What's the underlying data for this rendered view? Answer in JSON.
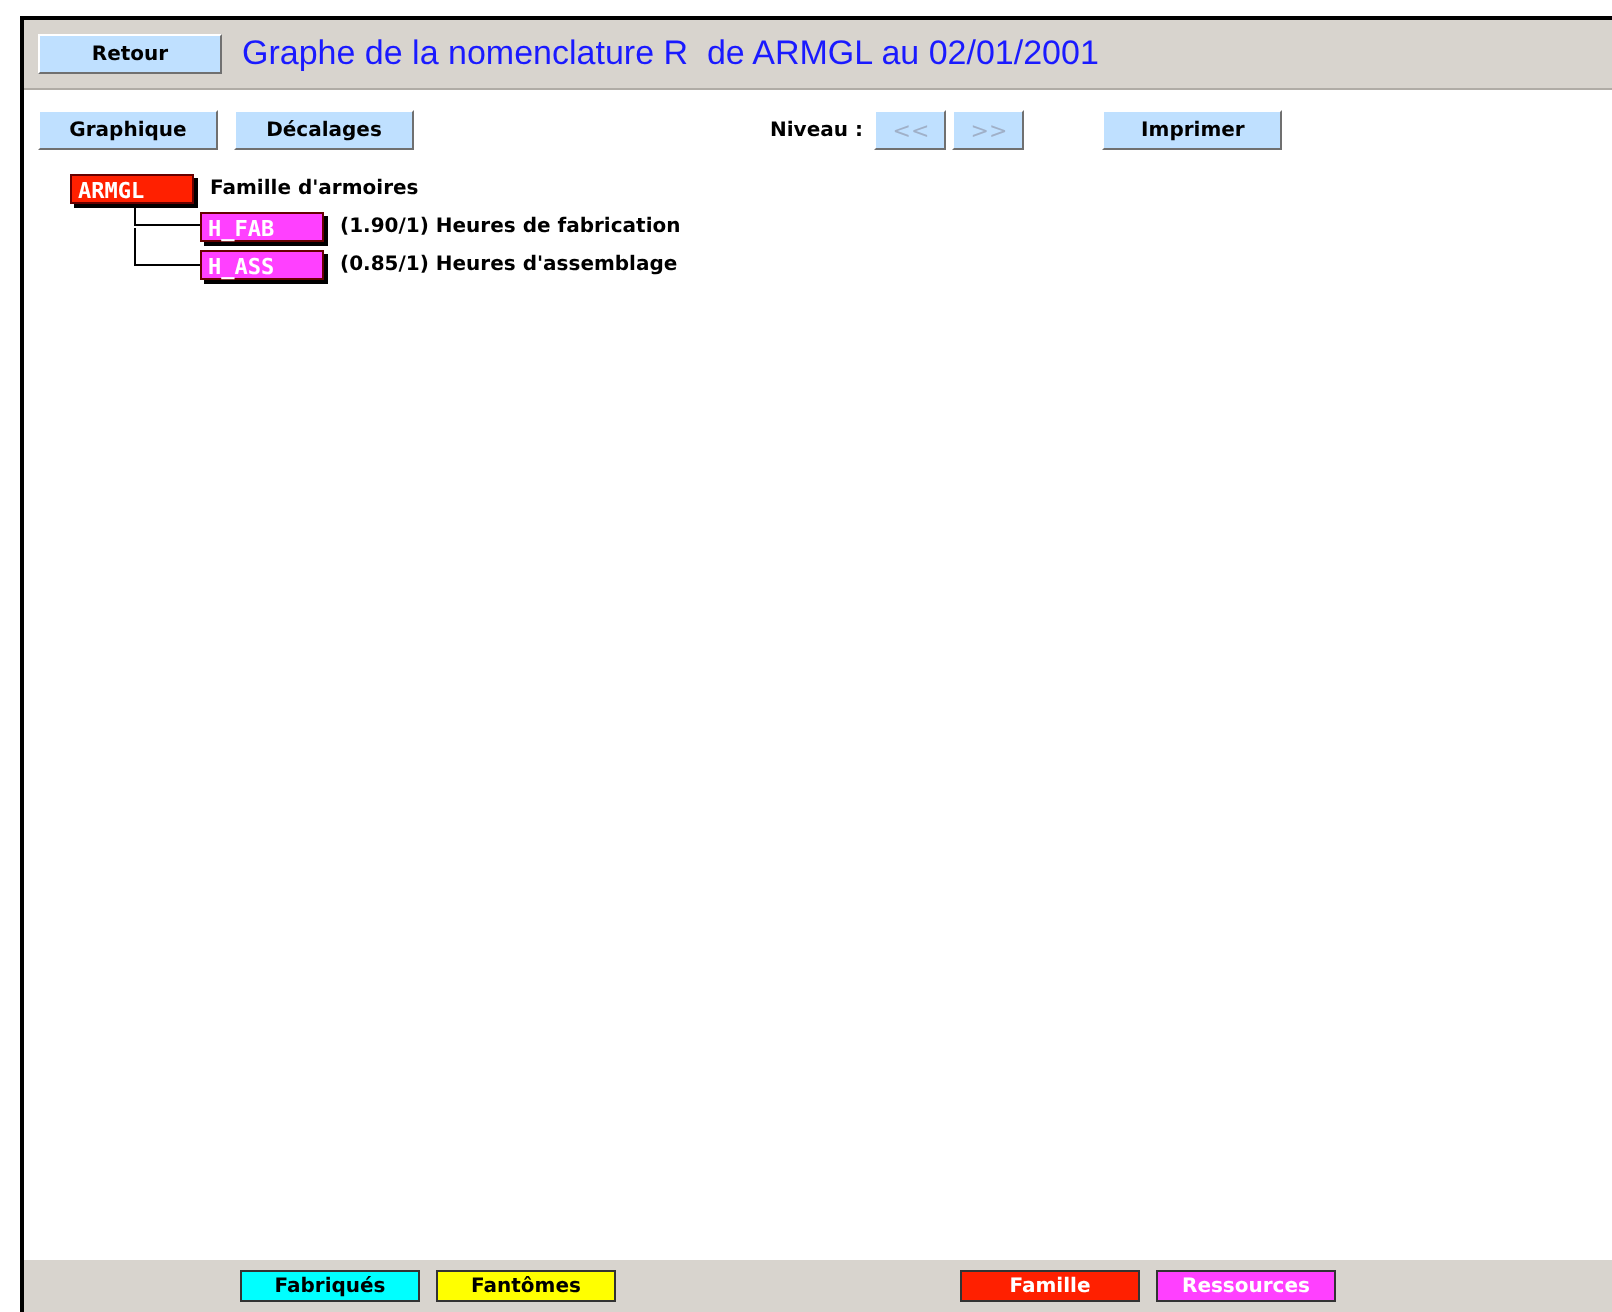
{
  "header": {
    "back_button": "Retour",
    "title": "Graphe de la nomenclature R  de ARMGL au 02/01/2001"
  },
  "toolbar": {
    "buttons": [
      {
        "label": "Graphique"
      },
      {
        "label": "Décalages"
      }
    ],
    "level_label": "Niveau :",
    "level_buttons": [
      {
        "label": "<<",
        "disabled": true
      },
      {
        "label": ">>",
        "disabled": true
      }
    ],
    "print_button": "Imprimer"
  },
  "tree": {
    "code": "ARMGL",
    "label": "Famille d'armoires",
    "color": "#ff2000",
    "children": [
      {
        "code": "H_FAB",
        "label": "(1.90/1) Heures de fabrication",
        "color": "#ff40ff"
      },
      {
        "code": "H_ASS",
        "label": "(0.85/1) Heures d'assemblage",
        "color": "#ff40ff"
      }
    ]
  },
  "legend": [
    {
      "label": "Fabriqués",
      "color": "#00ffff",
      "text_light": false
    },
    {
      "label": "Fantômes",
      "color": "#ffff00",
      "text_light": false
    },
    {
      "label": "Famille",
      "color": "#ff2000",
      "text_light": true
    },
    {
      "label": "Ressources",
      "color": "#ff40ff",
      "text_light": true
    }
  ]
}
